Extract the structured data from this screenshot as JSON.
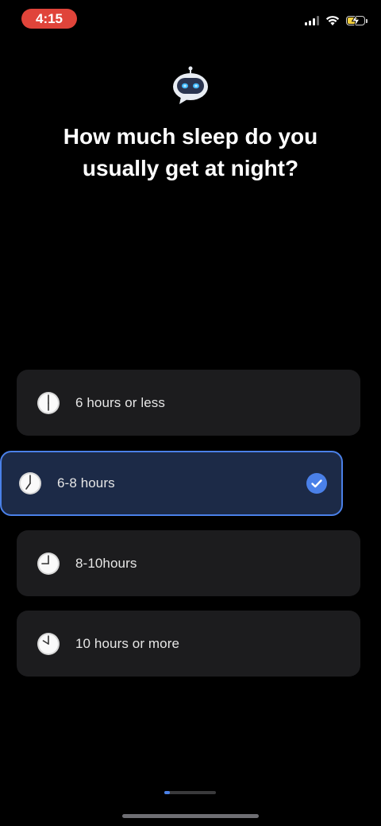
{
  "status_bar": {
    "time": "4:15",
    "time_pill_color": "#e0443a",
    "signal_icon": "cellular-signal-icon",
    "wifi_icon": "wifi-icon",
    "battery_icon": "battery-charging-icon"
  },
  "header": {
    "icon": "robot-chat-icon",
    "title": "How much sleep do you usually get at night?"
  },
  "options": [
    {
      "label": "6 hours or less",
      "icon": "clock-six-icon",
      "selected": false
    },
    {
      "label": "6-8 hours",
      "icon": "clock-seven-icon",
      "selected": true
    },
    {
      "label": "8-10hours",
      "icon": "clock-nine-icon",
      "selected": false
    },
    {
      "label": "10 hours or more",
      "icon": "clock-ten-icon",
      "selected": false
    }
  ],
  "progress": {
    "fraction": 0.1,
    "accent_color": "#4a80e8"
  },
  "colors": {
    "background": "#000000",
    "card": "#1c1c1e",
    "selected_card": "#1c2a47",
    "accent": "#4a80e8"
  }
}
